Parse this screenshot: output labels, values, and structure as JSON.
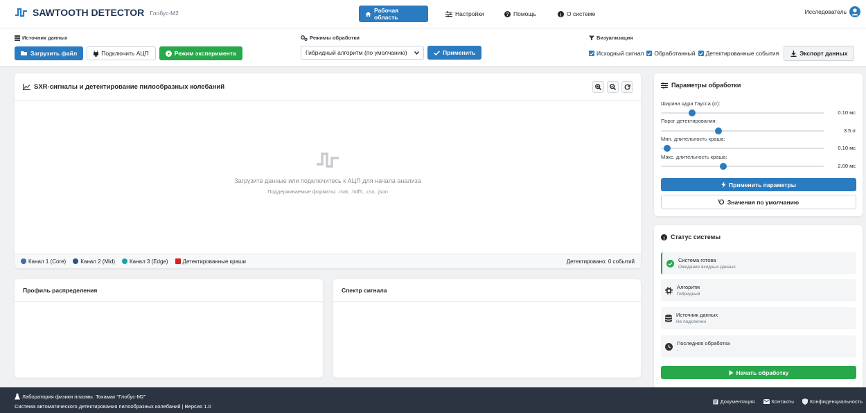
{
  "navbar": {
    "brand": "SAWTOOTH DETECTOR",
    "device": "Глобус-М2",
    "nav": [
      {
        "label": "Рабочая область",
        "icon": "home-icon",
        "active": true
      },
      {
        "label": "Настройки",
        "icon": "sliders-icon"
      },
      {
        "label": "Помощь",
        "icon": "question-circle-icon"
      },
      {
        "label": "О системе",
        "icon": "info-circle-icon"
      }
    ],
    "user": "Исследователь"
  },
  "toolbar": {
    "source_label": "Источник данных",
    "load_file": "Загрузить файл",
    "connect_adc": "Подключить АЦП",
    "experiment_mode": "Режим эксперимента",
    "modes_label": "Режимы обработки",
    "mode_selected": "Гибридный алгоритм (по умолчанию)",
    "apply": "Применить",
    "viz_label": "Визуализация",
    "checkboxes": [
      {
        "label": "Исходный сигнал",
        "checked": true
      },
      {
        "label": "Обработанный",
        "checked": true
      },
      {
        "label": "Детектированные события",
        "checked": true
      }
    ],
    "export": "Экспорт данных"
  },
  "main_chart": {
    "title": "SXR-сигналы и детектирование пилообразных колебаний",
    "empty_message": "Загрузите данные или подключитесь к АЦП для начала анализа",
    "formats": "Поддерживаемые форматы: .mat, .hdf5, .csv, .json",
    "legend": [
      {
        "label": "Канал 1 (Core)",
        "color": "#3d6ea3"
      },
      {
        "label": "Канал 2 (Mid)",
        "color": "#2c5282"
      },
      {
        "label": "Канал 3 (Edge)",
        "color": "#1aa5a0"
      },
      {
        "label": "Детектированные краши",
        "color": "#d61f26"
      }
    ],
    "detected": "Детектировано: 0 событий"
  },
  "profile_panel": {
    "title": "Профиль распределения"
  },
  "spectrum_panel": {
    "title": "Спектр сигнала"
  },
  "params": {
    "title": "Параметры обработки",
    "sliders": [
      {
        "label": "Ширина ядра Гаусса (σ):",
        "value": "0.10 мс",
        "fraction": 0.19
      },
      {
        "label": "Порог детектирования:",
        "value": "3.5 σ",
        "fraction": 0.35
      },
      {
        "label": "Мин. длительность краша:",
        "value": "0.10 мс",
        "fraction": 0.04
      },
      {
        "label": "Макс. длительность краша:",
        "value": "2.00 мс",
        "fraction": 0.38
      }
    ],
    "apply": "Применить параметры",
    "defaults": "Значения по умолчанию"
  },
  "status": {
    "title": "Статус системы",
    "items": [
      {
        "main": "Система готова",
        "sub": "Ожидание входных данных",
        "icon": "check-circle-icon"
      },
      {
        "main": "Алгоритм",
        "sub": "Гибридный",
        "icon": "cpu-icon"
      },
      {
        "main": "Источник данных",
        "sub": "Не подключен",
        "icon": "database-icon"
      },
      {
        "main": "Последняя обработка",
        "sub": "-",
        "icon": "clock-icon"
      }
    ],
    "start": "Начать обработку"
  },
  "footer": {
    "lab": "Лаборатория физики плазмы. Токамак \"Глобус-М2\"",
    "system": "Система автоматического детектирования пилообразных колебаний | Версия 1.0",
    "links": [
      "Документация",
      "Контакты",
      "Конфиденциальность"
    ]
  },
  "colors": {
    "primary": "#2a7bc0",
    "success": "#27a84a",
    "footer": "#2b3440",
    "brand": "#2a7bc0"
  }
}
